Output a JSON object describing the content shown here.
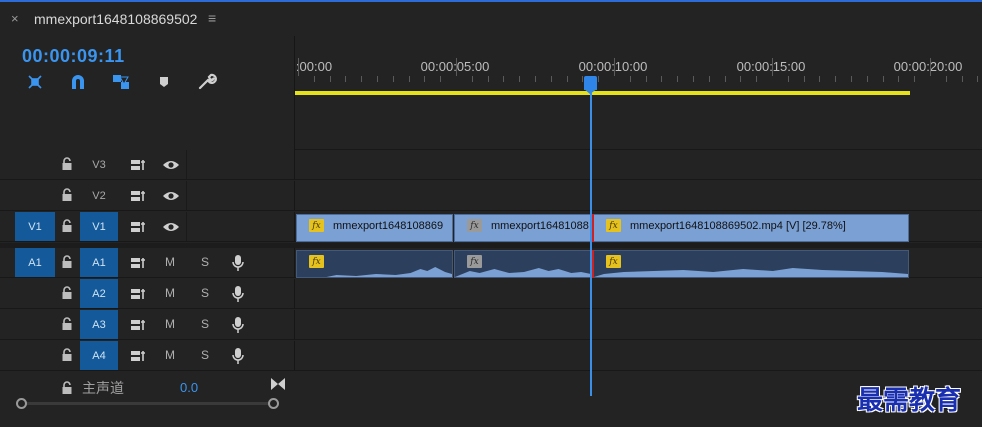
{
  "tab": {
    "close_glyph": "×",
    "title": "mmexport1648108869502",
    "menu_glyph": "≡"
  },
  "timecode": "00:00:09:11",
  "tools": [
    {
      "name": "nest-toggle-icon"
    },
    {
      "name": "snap-magnet-icon"
    },
    {
      "name": "linked-selection-icon"
    },
    {
      "name": "add-marker-icon"
    },
    {
      "name": "settings-wrench-icon"
    }
  ],
  "ruler": {
    "labels": [
      ":00:00",
      "00:00:05:00",
      "00:00:10:00",
      "00:00:15:00",
      "00:00:20:00"
    ]
  },
  "video_tracks": [
    {
      "target": "V3",
      "source": "",
      "target_on": false
    },
    {
      "target": "V2",
      "source": "",
      "target_on": false
    },
    {
      "target": "V1",
      "source": "V1",
      "target_on": true
    }
  ],
  "audio_tracks": [
    {
      "target": "A1",
      "source": "A1",
      "mute": "M",
      "solo": "S"
    },
    {
      "target": "A2",
      "source": "",
      "mute": "M",
      "solo": "S"
    },
    {
      "target": "A3",
      "source": "",
      "mute": "M",
      "solo": "S"
    },
    {
      "target": "A4",
      "source": "",
      "mute": "M",
      "solo": "S"
    }
  ],
  "clips": {
    "video": [
      {
        "name": "mmexport1648108869",
        "fx": "fx"
      },
      {
        "name": "mmexport16481088",
        "fx": "fx"
      },
      {
        "name": "mmexport1648108869502.mp4 [V] [29.78%]",
        "fx": "fx"
      }
    ],
    "audio": [
      {
        "fx": "fx"
      },
      {
        "fx": "fx"
      },
      {
        "fx": "fx"
      }
    ]
  },
  "master": {
    "label": "主声道",
    "value": "0.0"
  },
  "watermark": "最需教育",
  "colors": {
    "accent": "#3a95f0",
    "patch": "#145a9a",
    "video_clip": "#7ba0d4",
    "audio_clip": "#2c3f5c",
    "work_area": "#e5e21a",
    "fx_badge": "#e5c21e"
  }
}
